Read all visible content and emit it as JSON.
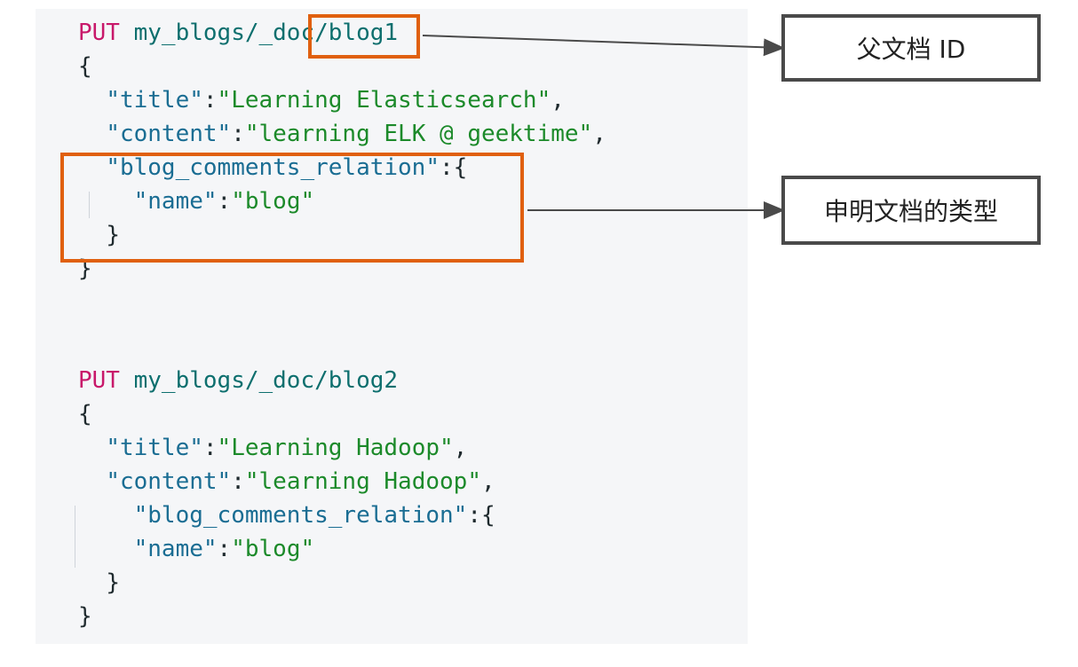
{
  "code": {
    "block1": {
      "method": "PUT",
      "path_prefix": "my_blogs/_doc/",
      "doc_id": "blog1",
      "open_brace": "{",
      "title_key": "\"title\"",
      "title_value": "\"Learning Elasticsearch\"",
      "content_key": "\"content\"",
      "content_value": "\"learning ELK @ geektime\"",
      "relation_key": "\"blog_comments_relation\"",
      "name_key": "\"name\"",
      "name_value": "\"blog\"",
      "inner_close": "}",
      "close_brace": "}"
    },
    "block2": {
      "method": "PUT",
      "path": "my_blogs/_doc/blog2",
      "open_brace": "{",
      "title_key": "\"title\"",
      "title_value": "\"Learning Hadoop\"",
      "content_key": "\"content\"",
      "content_value": "\"learning Hadoop\"",
      "relation_key": "\"blog_comments_relation\"",
      "name_key": "\"name\"",
      "name_value": "\"blog\"",
      "inner_close": "}",
      "close_brace": "}"
    }
  },
  "callouts": {
    "parent_id": "父文档 ID",
    "doc_type": "申明文档的类型"
  },
  "colors": {
    "highlight": "#e0600f",
    "callout_border": "#4a4a4a",
    "code_background": "#f5f6f8",
    "keyword": "#c8186a",
    "string": "#1c8a2a",
    "key": "#1a6d93"
  }
}
